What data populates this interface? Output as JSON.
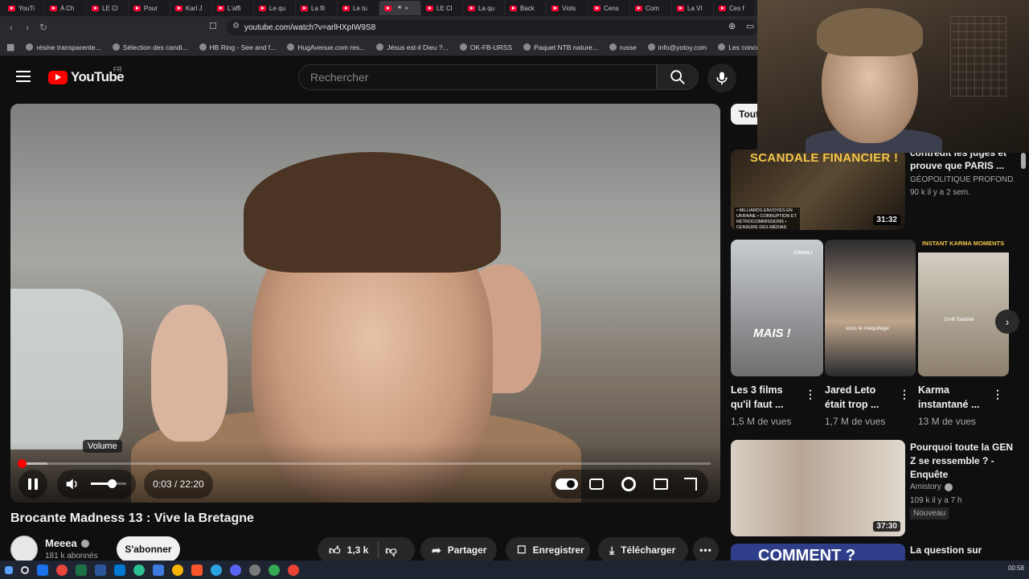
{
  "browser": {
    "tabs": [
      {
        "label": "YouTi",
        "active": false
      },
      {
        "label": "A Ch",
        "active": false
      },
      {
        "label": "LE Cl",
        "active": false
      },
      {
        "label": "Pour",
        "active": false
      },
      {
        "label": "Karl J",
        "active": false
      },
      {
        "label": "L'affi",
        "active": false
      },
      {
        "label": "Le qu",
        "active": false
      },
      {
        "label": "La fil",
        "active": false
      },
      {
        "label": "Le tu",
        "active": false
      },
      {
        "label": "",
        "active": true
      },
      {
        "label": "LE Cl",
        "active": false
      },
      {
        "label": "La qu",
        "active": false
      },
      {
        "label": "Back",
        "active": false
      },
      {
        "label": "Viols",
        "active": false
      },
      {
        "label": "Cens",
        "active": false
      },
      {
        "label": "Com",
        "active": false
      },
      {
        "label": "La VI",
        "active": false
      },
      {
        "label": "Ces f",
        "active": false
      }
    ],
    "url": "youtube.com/watch?v=arlHXpIW9S8",
    "bookmarks": [
      "résine transparente...",
      "Sélection des candi...",
      "HB Ring - See and f...",
      "HugAvenue.com res...",
      "Jésus est-il Dieu ?...",
      "OK-FB-URSS",
      "Paquet NTB nature...",
      "russe",
      "info@yotoy.com",
      "Les concours d'aute..."
    ]
  },
  "header": {
    "logo_text": "YouTube",
    "region": "FR",
    "search_placeholder": "Rechercher",
    "icons": [
      "menu-icon",
      "search-icon",
      "mic-icon"
    ]
  },
  "player": {
    "current_time": "0:03",
    "duration": "22:20",
    "time_display": "0:03 / 22:20",
    "progress_fraction": 0.002,
    "buffer_fraction": 0.04,
    "volume_fraction": 0.6,
    "volume_tooltip": "Volume",
    "autoplay_on": true
  },
  "video": {
    "title": "Brocante Madness 13 : Vive la Bretagne",
    "channel": "Meeea",
    "subscribers": "181 k abonnés",
    "subscribe_label": "S'abonner",
    "likes": "1,3 k",
    "share_label": "Partager",
    "save_label": "Enregistrer",
    "download_label": "Télécharger"
  },
  "sidebar": {
    "chip": "Tout",
    "recommended": [
      {
        "title": "contredit les juges et prouve que PARIS ...",
        "channel": "GÉOPOLITIQUE PROFOND...",
        "meta": "90 k  il y a 2 sem.",
        "duration": "31:32",
        "thumb_text": "SCANDALE FINANCIER !",
        "thumb_sub": "• MILLIARDS ENVOYÉS EN UKRAINE • CORRUPTION ET RÉTROCOMMISSIONS • CENSURE DES MÉDIAS"
      },
      {
        "title": "Pourquoi toute la GEN Z se ressemble ? - Enquête",
        "channel": "Amistory",
        "meta": "109 k  il y a 7 h",
        "badge": "Nouveau",
        "duration": "37:30"
      },
      {
        "title": "La question sur",
        "thumb_text": "COMMENT ?"
      }
    ],
    "shorts": [
      {
        "title": "Les 3 films qu'il faut ...",
        "views": "1,5 M de vues",
        "overlay": "MAIS !",
        "badge": "CANAL+"
      },
      {
        "title": "Jared Leto était trop ...",
        "views": "1,7 M de vues",
        "caption": "sous le maquillage"
      },
      {
        "title": "Karma instantané ...",
        "views": "13 M de vues",
        "top_text": "INSTANT KARMA MOMENTS",
        "caption": "Orvill Sandiné"
      }
    ]
  },
  "taskbar": {
    "clock": "00:58"
  }
}
